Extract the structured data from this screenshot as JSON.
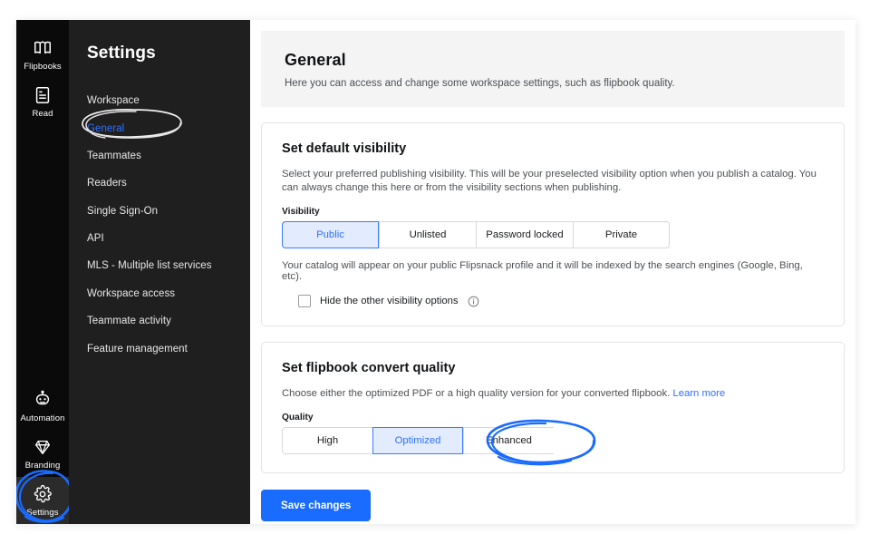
{
  "rail": {
    "items": [
      {
        "label": "Flipbooks",
        "icon": "book-icon",
        "active": false
      },
      {
        "label": "Read",
        "icon": "document-icon",
        "active": false
      },
      {
        "label": "Automation",
        "icon": "robot-icon",
        "active": false
      },
      {
        "label": "Branding",
        "icon": "diamond-icon",
        "active": false
      },
      {
        "label": "Settings",
        "icon": "gear-icon",
        "active": true
      }
    ]
  },
  "settings_panel": {
    "title": "Settings",
    "nav_items": [
      {
        "label": "Workspace",
        "selected": false
      },
      {
        "label": "General",
        "selected": true
      },
      {
        "label": "Teammates",
        "selected": false
      },
      {
        "label": "Readers",
        "selected": false
      },
      {
        "label": "Single Sign-On",
        "selected": false
      },
      {
        "label": "API",
        "selected": false
      },
      {
        "label": "MLS - Multiple list services",
        "selected": false
      },
      {
        "label": "Workspace access",
        "selected": false
      },
      {
        "label": "Teammate activity",
        "selected": false
      },
      {
        "label": "Feature management",
        "selected": false
      }
    ]
  },
  "header": {
    "title": "General",
    "subtitle": "Here you can access and change some workspace settings, such as flipbook quality."
  },
  "visibility_card": {
    "title": "Set default visibility",
    "description": "Select your preferred publishing visibility. This will be your preselected visibility option when you publish a catalog. You can always change this here or from the visibility sections when publishing.",
    "field_label": "Visibility",
    "options": [
      {
        "label": "Public",
        "selected": true
      },
      {
        "label": "Unlisted",
        "selected": false
      },
      {
        "label": "Password locked",
        "selected": false
      },
      {
        "label": "Private",
        "selected": false
      }
    ],
    "note": "Your catalog will appear on your public Flipsnack profile and it will be indexed by the search engines (Google, Bing, etc).",
    "checkbox_label": "Hide the other visibility options",
    "checkbox_checked": false,
    "info_icon": "info-icon"
  },
  "quality_card": {
    "title": "Set flipbook convert quality",
    "description": "Choose either the optimized PDF or a high quality version for your converted flipbook.",
    "learn_more": "Learn more",
    "field_label": "Quality",
    "options": [
      {
        "label": "High",
        "selected": false
      },
      {
        "label": "Optimized",
        "selected": true
      },
      {
        "label": "Enhanced",
        "selected": false
      }
    ]
  },
  "footer": {
    "save_label": "Save changes"
  },
  "annotations": [
    {
      "name": "general-nav-circle",
      "target": "General",
      "color": "#f0f0f0"
    },
    {
      "name": "settings-rail-circle",
      "target": "Settings",
      "color": "#1a6bff"
    },
    {
      "name": "enhanced-option-circle",
      "target": "Enhanced",
      "color": "#1a6bff"
    }
  ],
  "colors": {
    "accent_blue": "#1a6bff",
    "selected_blue_text": "#2f6fff",
    "selected_blue_fill": "#e3ecff",
    "rail_black": "#0a0a0a",
    "panel_dark": "#1f1f1f",
    "header_gray": "#f4f4f5"
  }
}
